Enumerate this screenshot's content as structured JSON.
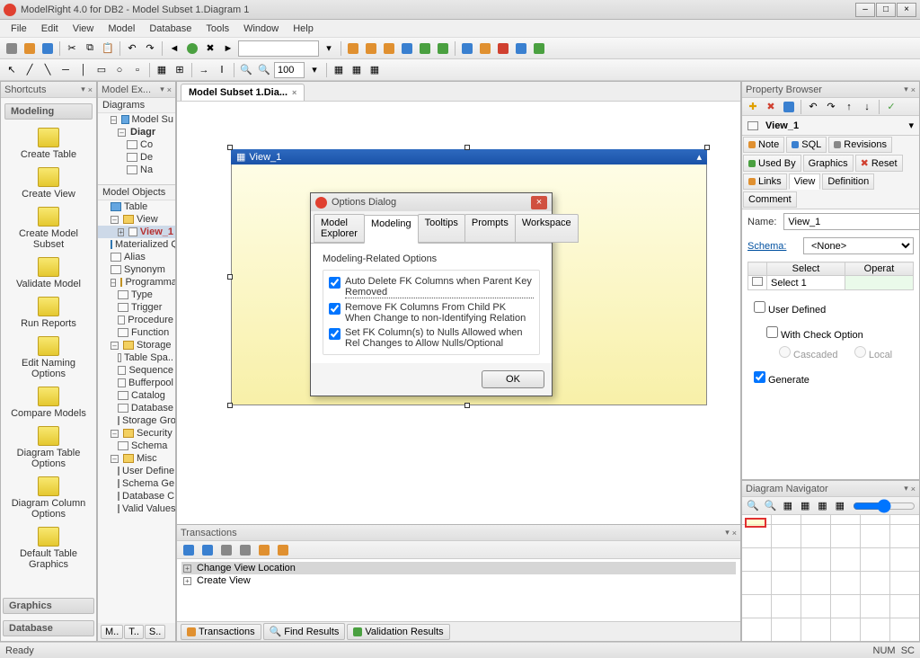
{
  "title": "ModelRight 4.0 for DB2 - Model Subset 1.Diagram 1",
  "menu": [
    "File",
    "Edit",
    "View",
    "Model",
    "Database",
    "Tools",
    "Window",
    "Help"
  ],
  "doc_tab": "Model Subset 1.Dia...",
  "shortcuts": {
    "header": "Shortcuts",
    "groups": {
      "modeling": "Modeling",
      "graphics": "Graphics",
      "database": "Database"
    },
    "items": [
      "Create Table",
      "Create View",
      "Create Model Subset",
      "Validate Model",
      "Run Reports",
      "Edit Naming Options",
      "Compare Models",
      "Diagram Table Options",
      "Diagram Column Options",
      "Default Table Graphics"
    ]
  },
  "model_explorer": {
    "header": "Model Ex...",
    "diagrams_hdr": "Diagrams",
    "diagrams": [
      "Model Su",
      "Diagr",
      "Co",
      "De",
      "Na"
    ],
    "objects_hdr": "Model Objects",
    "objects": {
      "table": "Table",
      "view": "View",
      "view1": "View_1",
      "matview": "Materialized Qu",
      "alias": "Alias",
      "synonym": "Synonym",
      "prog": "Programmabi..",
      "type": "Type",
      "trigger": "Trigger",
      "procedure": "Procedure",
      "function": "Function",
      "storage": "Storage",
      "tablespace": "Table Spa..",
      "sequence": "Sequence",
      "bufferpool": "Bufferpool",
      "catalog": "Catalog",
      "database": "Database",
      "stogroup": "Storage Gro",
      "security": "Security",
      "schema": "Schema",
      "misc": "Misc",
      "userdef": "User Define",
      "schemagen": "Schema Ge",
      "dbconn": "Database C",
      "validvals": "Valid Values"
    },
    "bottom_tabs": [
      "M..",
      "T..",
      "S.."
    ]
  },
  "view_canvas": {
    "title": "View_1"
  },
  "dialog": {
    "title": "Options Dialog",
    "tabs": [
      "Model Explorer",
      "Modeling",
      "Tooltips",
      "Prompts",
      "Workspace"
    ],
    "group": "Modeling-Related Options",
    "opts": [
      "Auto Delete FK Columns when Parent Key Removed",
      "Remove FK Columns From Child PK When Change to non-Identifying Relation",
      "Set FK Column(s) to Nulls Allowed when Rel Changes to Allow Nulls/Optional"
    ],
    "ok": "OK"
  },
  "transactions": {
    "header": "Transactions",
    "items": [
      "Change View Location",
      "Create View"
    ],
    "tabs": [
      "Transactions",
      "Find Results",
      "Validation Results"
    ]
  },
  "property_browser": {
    "header": "Property Browser",
    "obj_label": "View_1",
    "tabs_top": [
      "Note",
      "SQL",
      "Revisions",
      "Used By",
      "Graphics",
      "Reset",
      "Links",
      "View",
      "Definition",
      "Comment"
    ],
    "name_label": "Name:",
    "name_value": "View_1",
    "schema_label": "Schema:",
    "schema_value": "<None>",
    "table_hdrs": [
      "Select",
      "Operat"
    ],
    "table_row": "Select 1",
    "user_defined": "User Defined",
    "with_check": "With Check Option",
    "cascaded": "Cascaded",
    "local": "Local",
    "generate": "Generate"
  },
  "diagram_nav": {
    "header": "Diagram Navigator"
  },
  "status": {
    "ready": "Ready",
    "num": "NUM",
    "sc": "SC"
  },
  "zoom": "100"
}
